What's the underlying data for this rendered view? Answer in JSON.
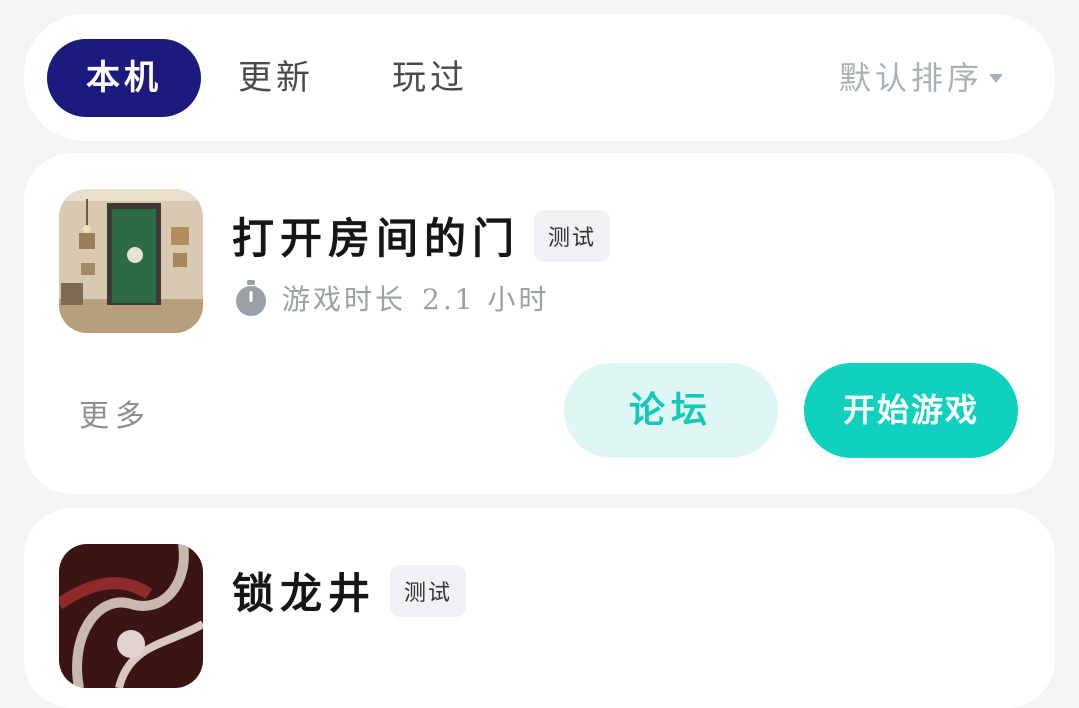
{
  "tabs": {
    "local": "本机",
    "update": "更新",
    "played": "玩过",
    "sort_label": "默认排序"
  },
  "games": [
    {
      "title": "打开房间的门",
      "badge": "测试",
      "playtime_label": "游戏时长",
      "playtime_value": "2.1 小时",
      "more_label": "更多",
      "forum_label": "论坛",
      "play_label": "开始游戏"
    },
    {
      "title": "锁龙井",
      "badge": "测试"
    }
  ],
  "colors": {
    "tab_active_bg": "#1c1a7c",
    "accent": "#0fd1bd",
    "accent_light": "#dff6f5"
  }
}
